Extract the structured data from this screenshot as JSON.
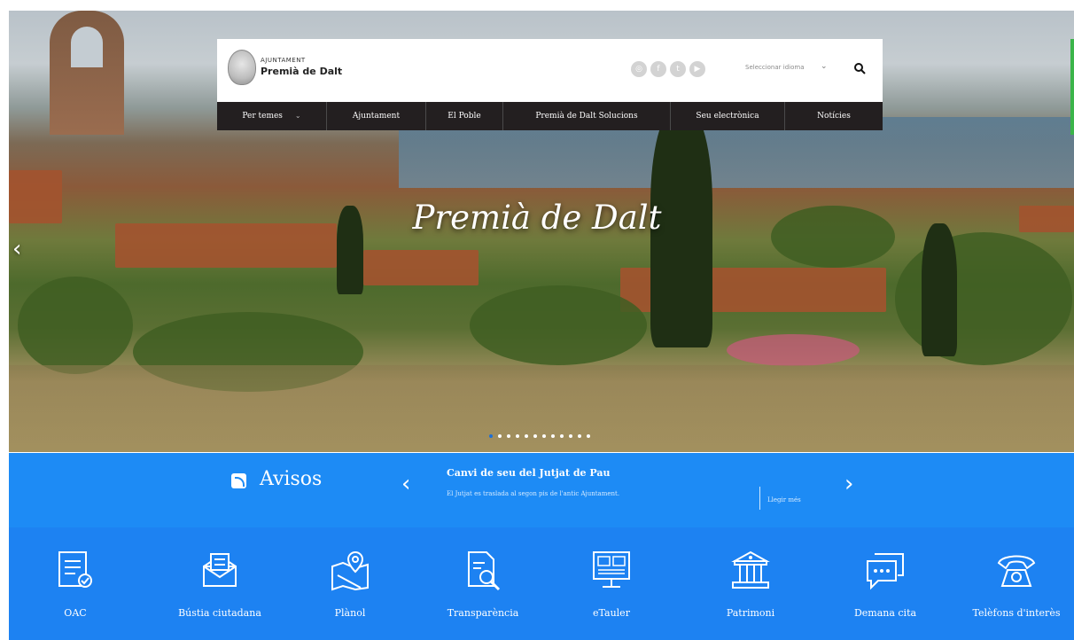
{
  "header": {
    "logo_top": "AJUNTAMENT",
    "logo_name": "Premià de Dalt",
    "language_select": "Seleccionar idioma",
    "social_icons": [
      "instagram-icon",
      "facebook-icon",
      "twitter-icon",
      "youtube-icon"
    ]
  },
  "nav": {
    "items": [
      "Per temes",
      "Ajuntament",
      "El Poble",
      "Premià de Dalt Solucions",
      "Seu electrònica",
      "Notícies"
    ]
  },
  "hero": {
    "title": "Premià de Dalt",
    "slide_count": 12,
    "active_slide": 1
  },
  "avisos": {
    "title": "Avisos",
    "headline": "Canvi de seu del Jutjat de Pau",
    "text": "El Jutjat es traslada al segon pis de l'antic Ajuntament.",
    "more": "Llegir més"
  },
  "quick_links": [
    {
      "label": "OAC",
      "icon": "form-check-icon"
    },
    {
      "label": "Bústia ciutadana",
      "icon": "mail-icon"
    },
    {
      "label": "Plànol",
      "icon": "map-pin-icon"
    },
    {
      "label": "Transparència",
      "icon": "document-search-icon"
    },
    {
      "label": "eTauler",
      "icon": "monitor-icon"
    },
    {
      "label": "Patrimoni",
      "icon": "building-icon"
    },
    {
      "label": "Demana cita",
      "icon": "chat-icon"
    },
    {
      "label": "Telèfons d'interès",
      "icon": "phone-icon"
    }
  ],
  "colors": {
    "avisos_bg": "#1d8bf5",
    "quick_bg": "#1d82f2",
    "nav_bg": "#231f20",
    "dot_active": "#1d6fd6"
  }
}
